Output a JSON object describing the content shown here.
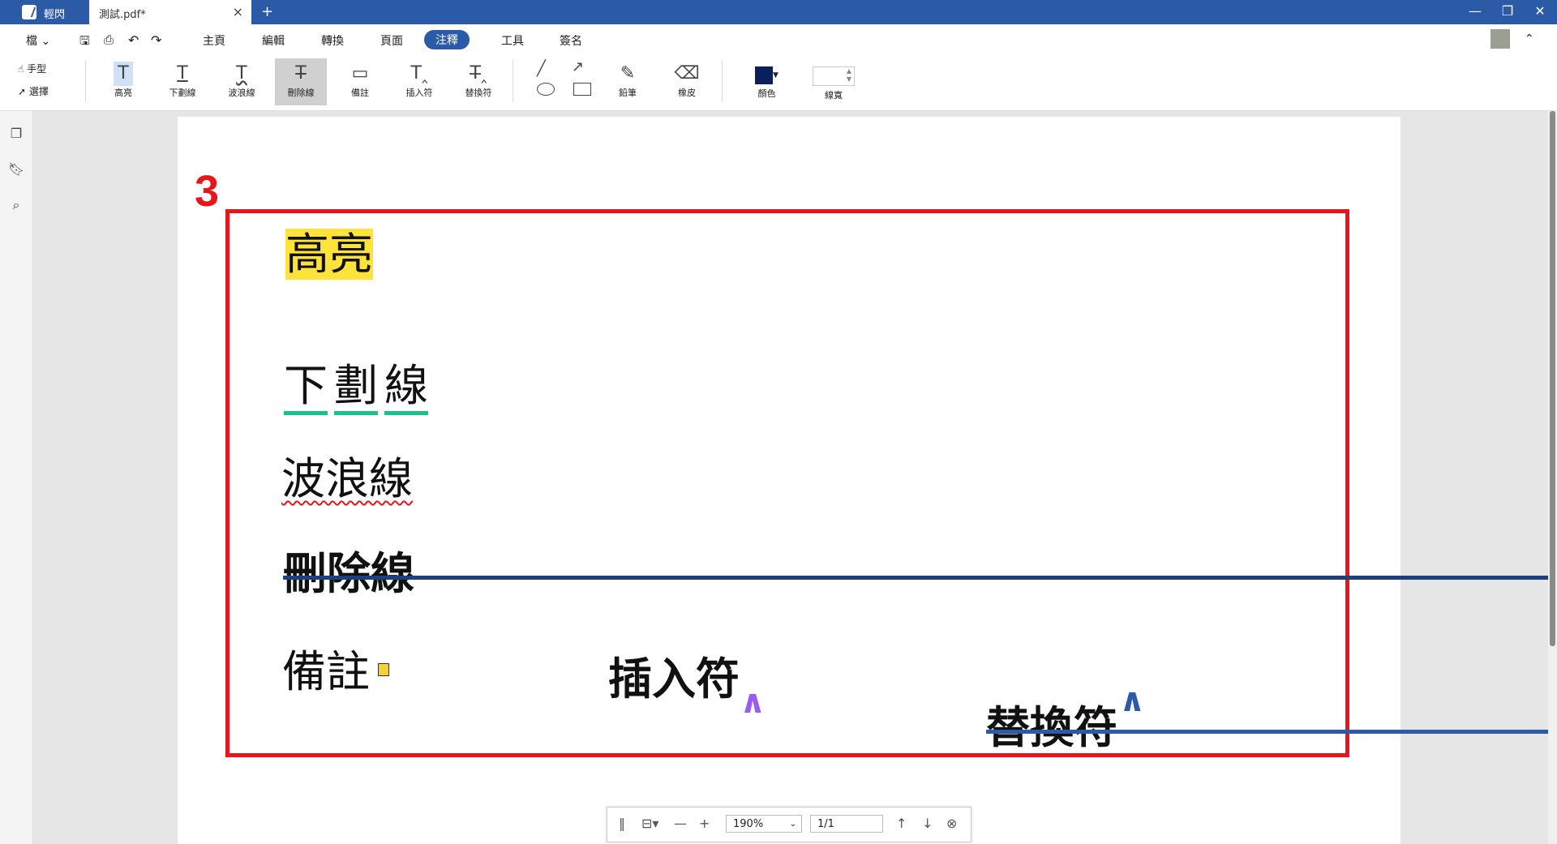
{
  "titlebar": {
    "app_name": "輕閃",
    "doc_tab": "測試.pdf*",
    "close": "×",
    "new_tab": "+",
    "min": "—",
    "restore": "❐",
    "win_close": "✕"
  },
  "menu": {
    "file": "檔",
    "items": [
      "主頁",
      "編輯",
      "轉換",
      "頁面",
      "注釋",
      "工具",
      "簽名"
    ],
    "active": "注釋"
  },
  "ribbon": {
    "hand": "手型",
    "select": "選擇",
    "tools": [
      "高亮",
      "下劃線",
      "波浪線",
      "刪除線",
      "備註",
      "插入符",
      "替換符"
    ],
    "pencil": "鉛筆",
    "eraser": "橡皮",
    "color_label": "顏色",
    "color_value": "#0a1f5c",
    "width_label": "線寬"
  },
  "document": {
    "number": "3",
    "highlight": "高亮",
    "underline": [
      "下",
      "劃",
      "線"
    ],
    "wavy": "波浪線",
    "strike": "刪除線",
    "note": "備註",
    "insert": "插入符",
    "replace": "替換符",
    "caret": "∧"
  },
  "bottombar": {
    "zoom": "190%",
    "page": "1/1"
  }
}
